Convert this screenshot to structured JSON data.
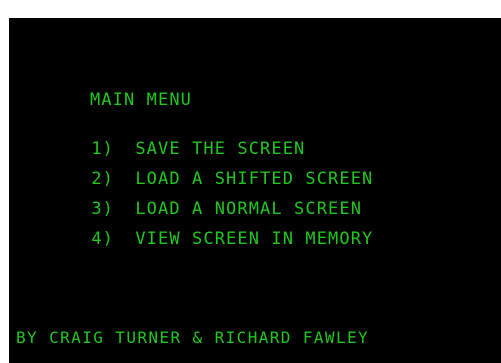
{
  "colors": {
    "background": "#000000",
    "text": "#1fc71f",
    "border": "#ffffff"
  },
  "menu": {
    "title": "MAIN MENU",
    "items": [
      {
        "number": "1)",
        "label": "SAVE THE SCREEN"
      },
      {
        "number": "2)",
        "label": "LOAD A SHIFTED SCREEN"
      },
      {
        "number": "3)",
        "label": "LOAD A NORMAL SCREEN"
      },
      {
        "number": "4)",
        "label": "VIEW SCREEN IN MEMORY"
      }
    ]
  },
  "credits": "BY CRAIG TURNER & RICHARD FAWLEY"
}
